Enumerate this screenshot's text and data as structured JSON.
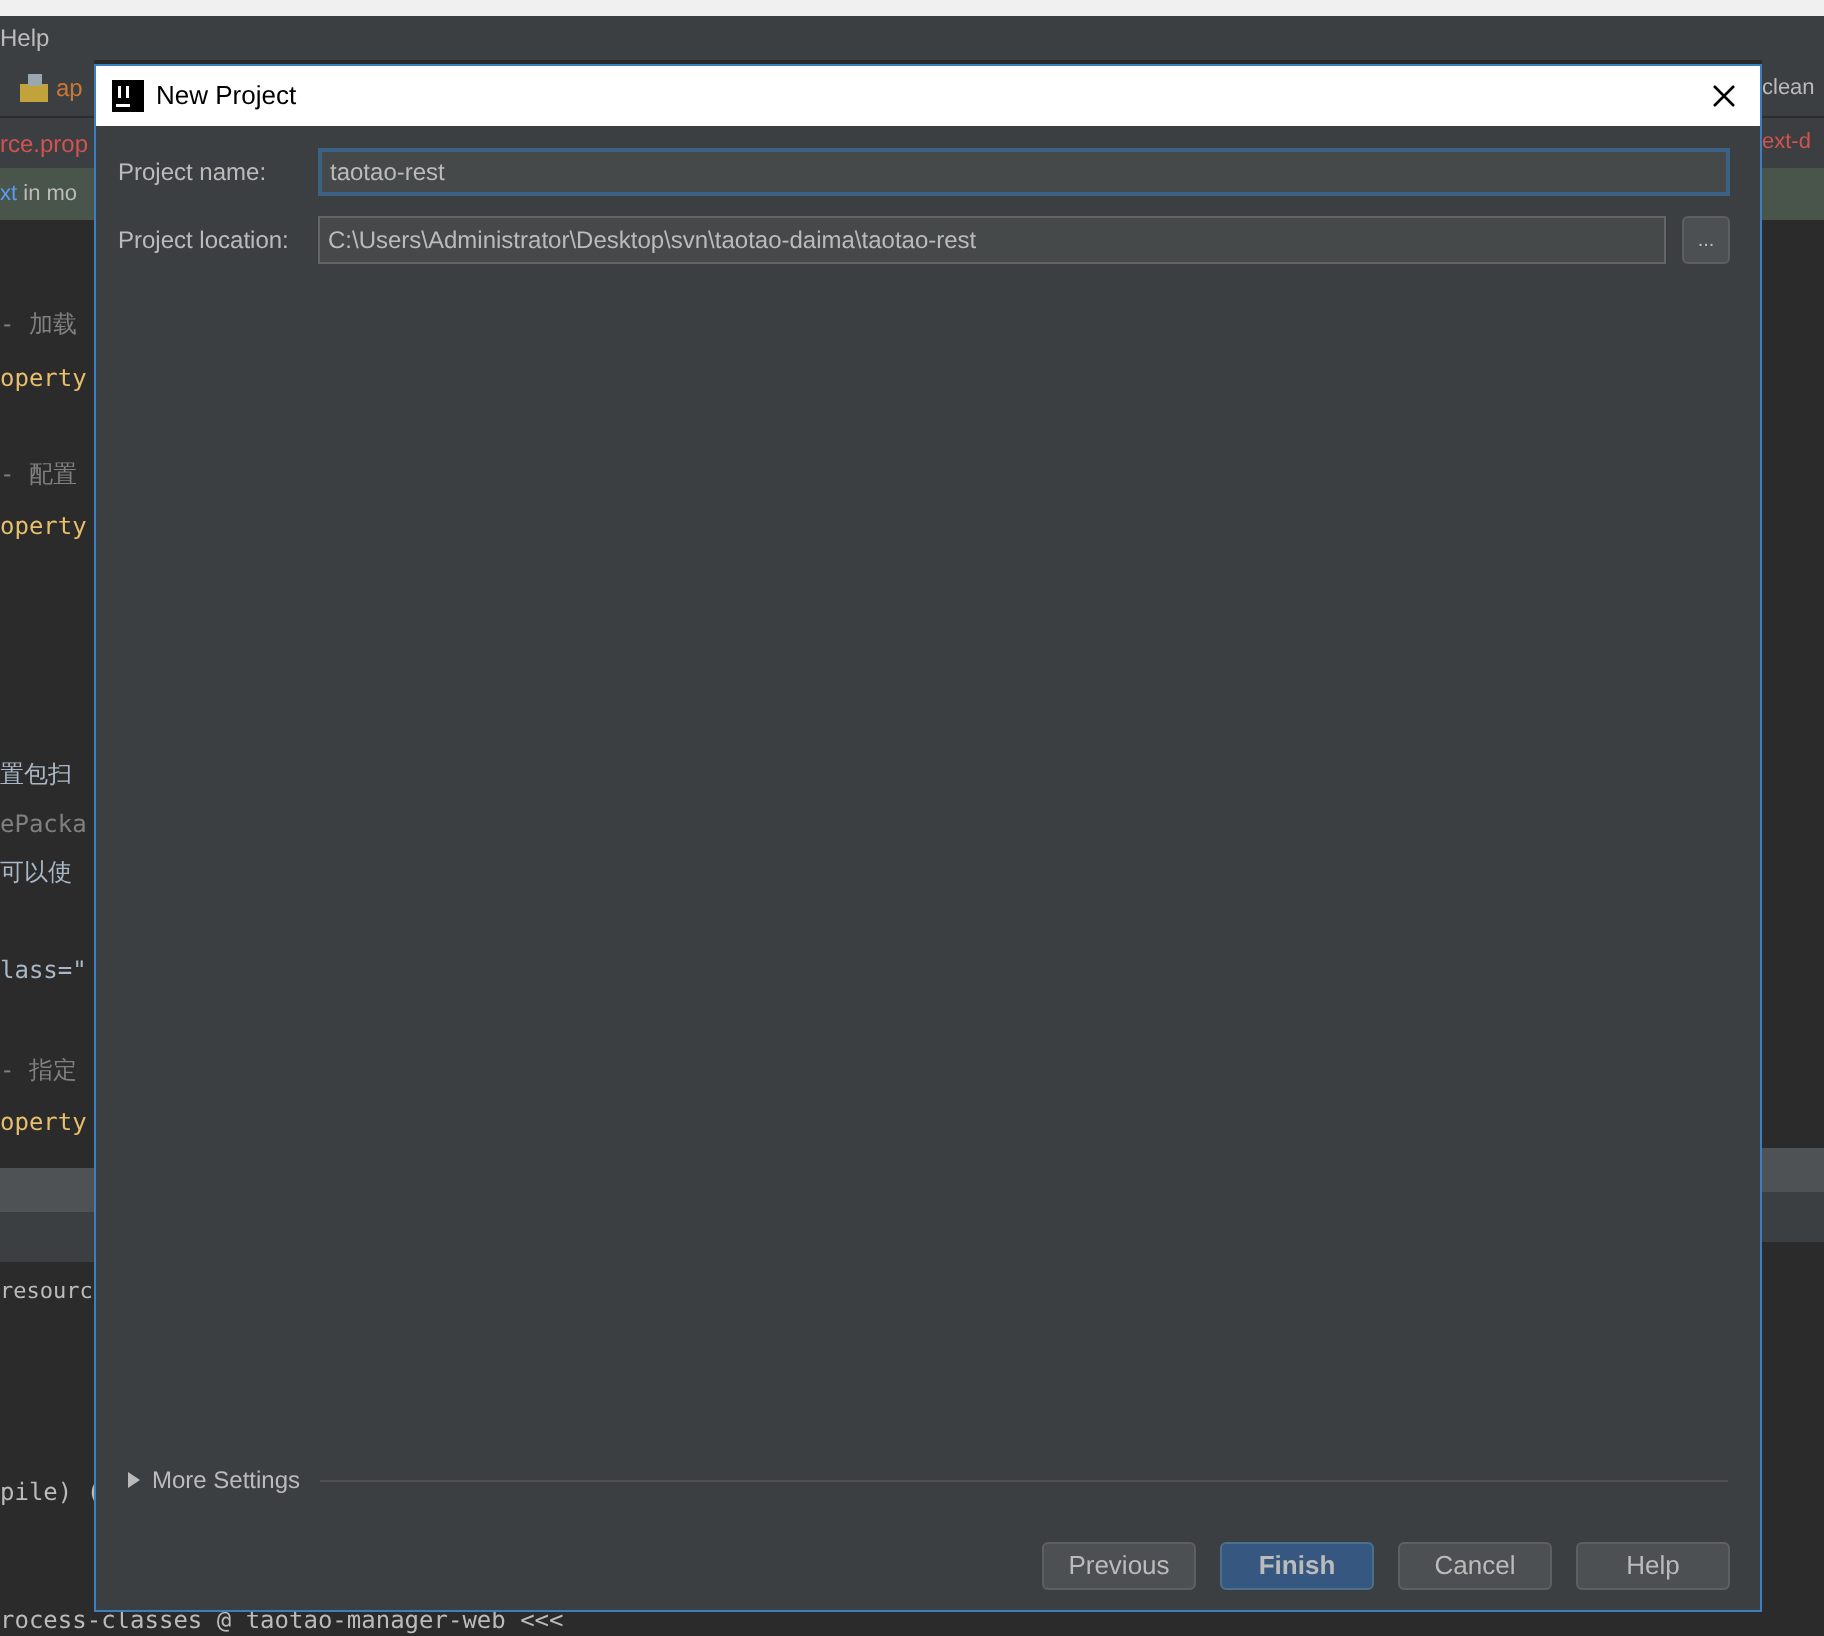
{
  "ide": {
    "menu": "Help",
    "editor_tab": "ap",
    "file_tab": "rce.prop",
    "hint": {
      "link": "xt",
      "text": " in mo"
    },
    "code_lines": [
      {
        "text": "- 加载",
        "kind": "comment"
      },
      {
        "text": "operty",
        "kind": "attr"
      },
      {
        "text": "- 配置",
        "kind": "comment"
      },
      {
        "text": "operty",
        "kind": "attr"
      },
      {
        "text": "置包扫",
        "kind": "plain"
      },
      {
        "text": "ePacka",
        "kind": "comment"
      },
      {
        "text": "可以使",
        "kind": "plain"
      },
      {
        "text": "lass=\"",
        "kind": "plain"
      },
      {
        "text": "- 指定",
        "kind": "comment"
      },
      {
        "text": "operty",
        "kind": "attr"
      }
    ],
    "console_lines": [
      {
        "text": "resourc"
      },
      {
        "text": "pile) ("
      },
      {
        "text": "rocess-classes @ taotao-manager-web <<<"
      }
    ],
    "right_tab": "clean",
    "right_file": "ext-d"
  },
  "dialog": {
    "title": "New Project",
    "fields": [
      {
        "label": "Project name:",
        "value": "taotao-rest",
        "focused": true
      },
      {
        "label": "Project location:",
        "value": "C:\\Users\\Administrator\\Desktop\\svn\\taotao-daima\\taotao-rest",
        "focused": false,
        "browse": "..."
      }
    ],
    "more_settings": {
      "label": "More Settings",
      "expanded": false
    },
    "buttons": [
      {
        "label": "Previous",
        "default": false
      },
      {
        "label": "Finish",
        "default": true
      },
      {
        "label": "Cancel",
        "default": false
      },
      {
        "label": "Help",
        "default": false
      }
    ]
  }
}
